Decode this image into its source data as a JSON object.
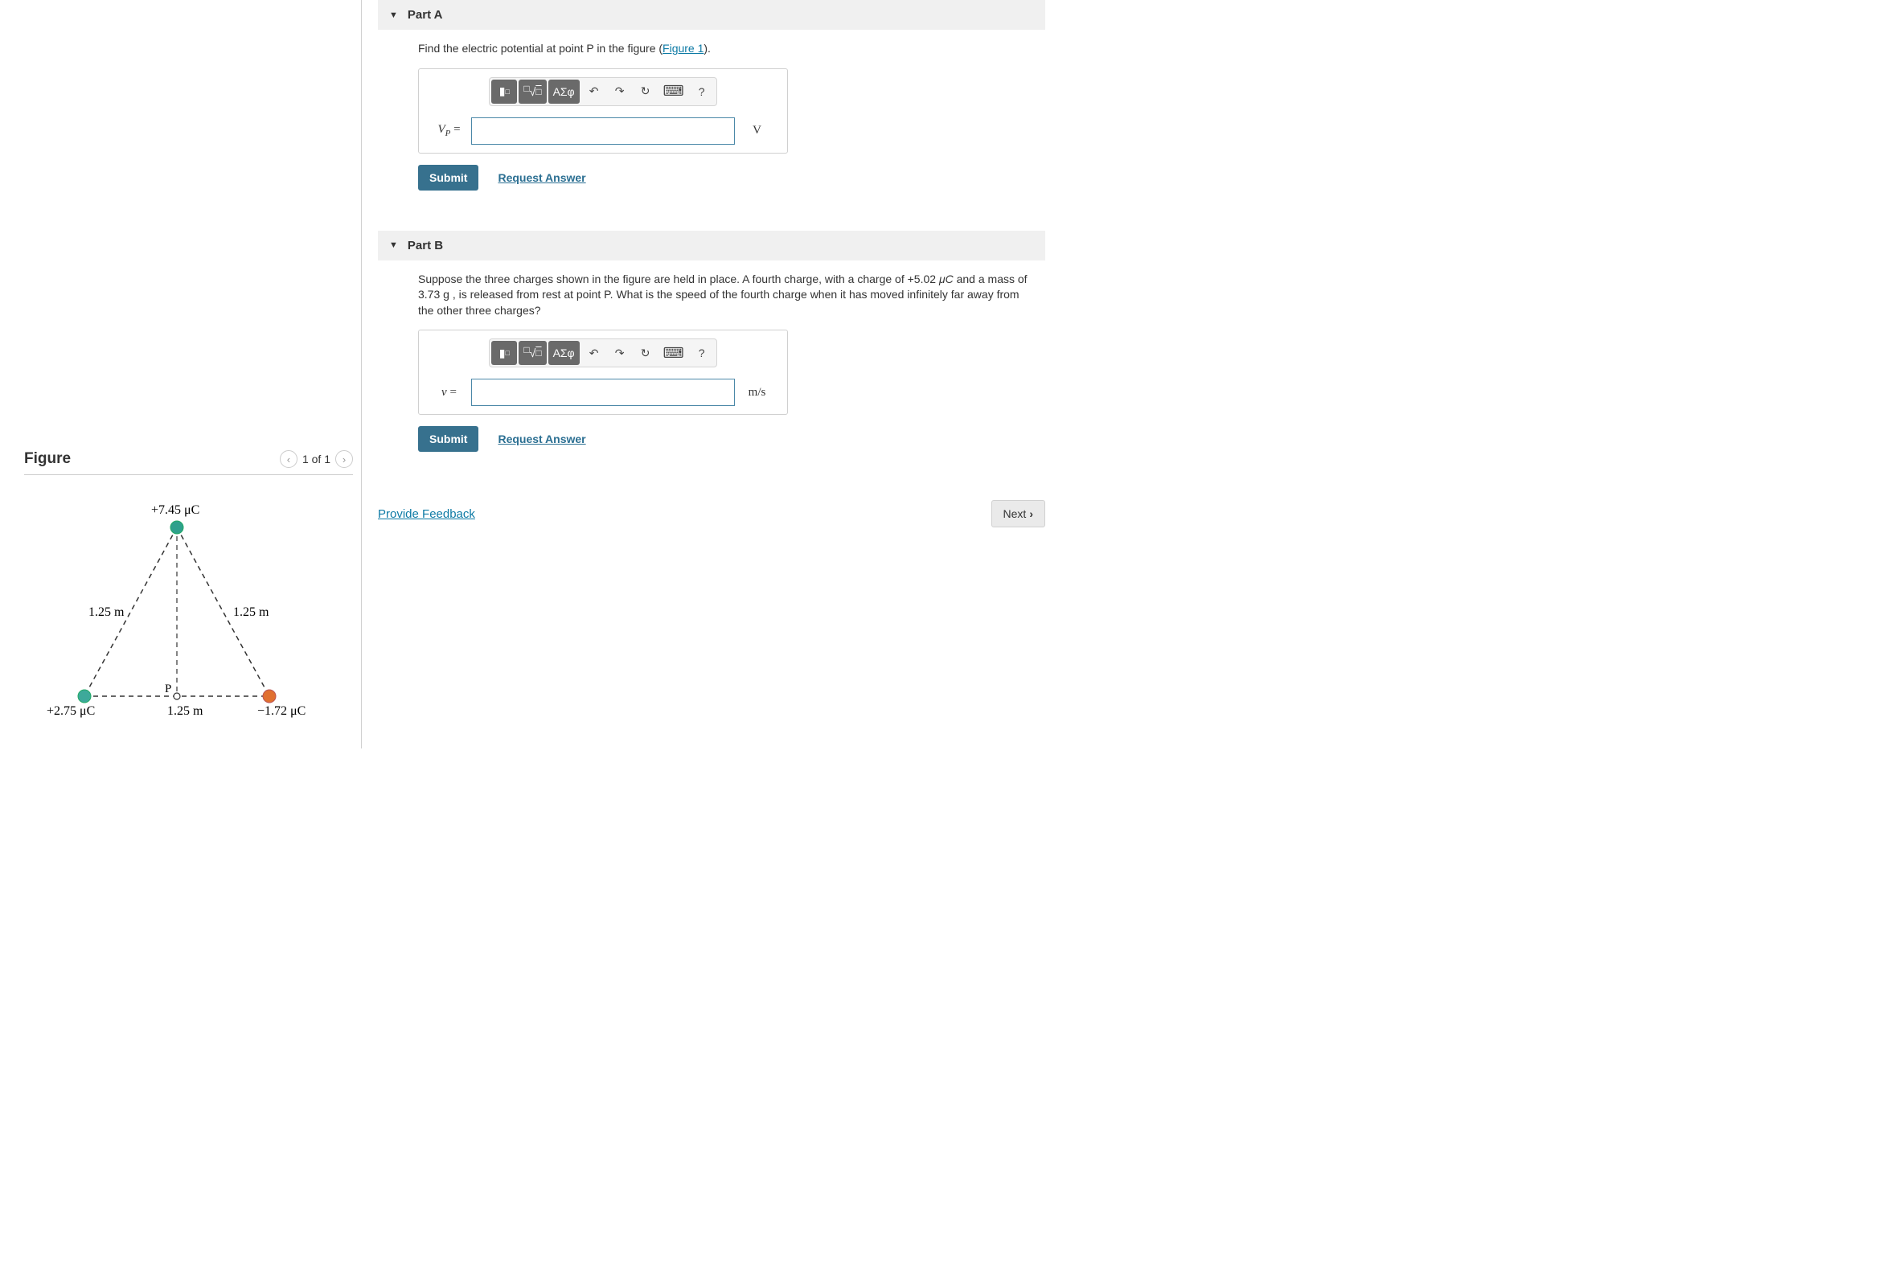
{
  "figure": {
    "title": "Figure",
    "nav": {
      "prev": "<",
      "count": "1 of 1",
      "next": ">"
    },
    "charges": {
      "top": {
        "label": "+7.45 μC"
      },
      "left": {
        "label": "+2.75 μC"
      },
      "right": {
        "label": "−1.72 μC"
      }
    },
    "sides": {
      "left": "1.25 m",
      "right": "1.25 m",
      "base": "1.25 m"
    },
    "pointP": "P"
  },
  "partA": {
    "header": "Part A",
    "prompt_pre": "Find the electric potential at point P in the figure (",
    "prompt_link": "Figure 1",
    "prompt_post": ").",
    "var_label": "V",
    "var_sub": "P",
    "eq": " = ",
    "unit": "V",
    "submit": "Submit",
    "request": "Request Answer"
  },
  "partB": {
    "header": "Part B",
    "prompt_pre": "Suppose the three charges shown in the figure are held in place. A fourth charge, with a charge of +5.02 ",
    "prompt_uc": "μC",
    "prompt_mid": " and a mass of 3.73 ",
    "prompt_g": "g",
    "prompt_post": " , is released from rest at point P. What is the speed of the fourth charge when it has moved infinitely far away from the other three charges?",
    "var_label": "v",
    "eq": " = ",
    "unit": "m/s",
    "submit": "Submit",
    "request": "Request Answer"
  },
  "toolbar": {
    "template": "template",
    "sqrt": "√",
    "greek": "ΑΣφ",
    "undo": "↶",
    "redo": "↷",
    "reset": "↻",
    "keyboard": "⌨",
    "help": "?"
  },
  "footer": {
    "feedback": "Provide Feedback",
    "next": "Next"
  }
}
